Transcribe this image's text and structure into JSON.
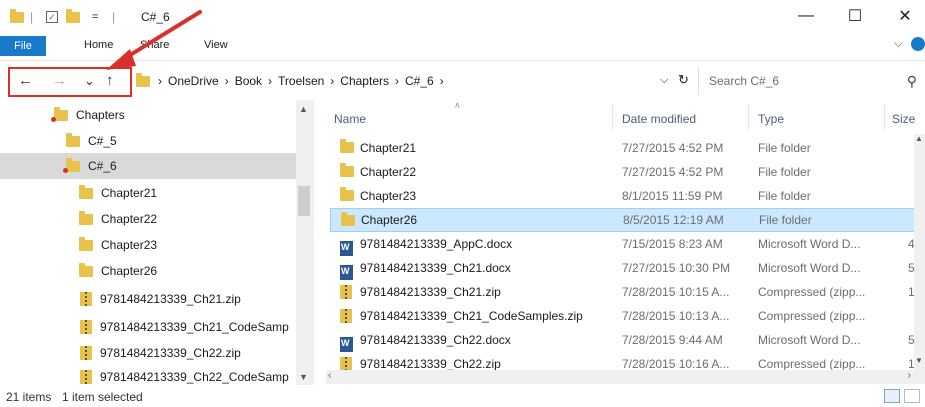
{
  "window": {
    "title": "C#_6",
    "qa_separator": "|",
    "qa_dropdown": "=",
    "min_glyph": "—",
    "max_glyph": "☐",
    "close_glyph": "✕"
  },
  "ribbon": {
    "tabs": [
      "File",
      "Home",
      "Share",
      "View"
    ],
    "expand_glyph": "⌵"
  },
  "address": {
    "back_glyph": "←",
    "forward_glyph": "→",
    "recent_glyph": "⌄",
    "up_glyph": "↑",
    "crumbs": [
      "›",
      "OneDrive",
      "›",
      "Book",
      "›",
      "Troelsen",
      "›",
      "Chapters",
      "›",
      "C#_6",
      "›"
    ],
    "dropdown_glyph": "⌵",
    "refresh_glyph": "↻",
    "search_placeholder": "Search C#_6",
    "search_glyph": "⚲"
  },
  "nav_tree": [
    {
      "label": "Chapters",
      "icon": "folder-pinned",
      "indent": 0,
      "selected": false
    },
    {
      "label": "C#_5",
      "icon": "folder",
      "indent": 1,
      "selected": false
    },
    {
      "label": "C#_6",
      "icon": "folder-pinned",
      "indent": 1,
      "selected": true
    },
    {
      "label": "Chapter21",
      "icon": "folder",
      "indent": 2,
      "selected": false
    },
    {
      "label": "Chapter22",
      "icon": "folder",
      "indent": 2,
      "selected": false
    },
    {
      "label": "Chapter23",
      "icon": "folder",
      "indent": 2,
      "selected": false
    },
    {
      "label": "Chapter26",
      "icon": "folder",
      "indent": 2,
      "selected": false
    },
    {
      "label": "9781484213339_Ch21.zip",
      "icon": "zip",
      "indent": 2,
      "selected": false
    },
    {
      "label": "9781484213339_Ch21_CodeSamp",
      "icon": "zip",
      "indent": 2,
      "selected": false
    },
    {
      "label": "9781484213339_Ch22.zip",
      "icon": "zip",
      "indent": 2,
      "selected": false
    },
    {
      "label": "9781484213339_Ch22_CodeSamp",
      "icon": "zip",
      "indent": 2,
      "selected": false
    }
  ],
  "columns": {
    "name": "Name",
    "date": "Date modified",
    "type": "Type",
    "size": "Size"
  },
  "files": [
    {
      "name": "Chapter21",
      "date": "7/27/2015 4:52 PM",
      "type": "File folder",
      "size": "",
      "icon": "folder",
      "selected": false
    },
    {
      "name": "Chapter22",
      "date": "7/27/2015 4:52 PM",
      "type": "File folder",
      "size": "",
      "icon": "folder",
      "selected": false
    },
    {
      "name": "Chapter23",
      "date": "8/1/2015 11:59 PM",
      "type": "File folder",
      "size": "",
      "icon": "folder",
      "selected": false
    },
    {
      "name": "Chapter26",
      "date": "8/5/2015 12:19 AM",
      "type": "File folder",
      "size": "",
      "icon": "folder",
      "selected": true
    },
    {
      "name": "9781484213339_AppC.docx",
      "date": "7/15/2015 8:23 AM",
      "type": "Microsoft Word D...",
      "size": "4",
      "icon": "docx",
      "selected": false
    },
    {
      "name": "9781484213339_Ch21.docx",
      "date": "7/27/2015 10:30 PM",
      "type": "Microsoft Word D...",
      "size": "5",
      "icon": "docx",
      "selected": false
    },
    {
      "name": "9781484213339_Ch21.zip",
      "date": "7/28/2015 10:15 A...",
      "type": "Compressed (zipp...",
      "size": "1",
      "icon": "zip",
      "selected": false
    },
    {
      "name": "9781484213339_Ch21_CodeSamples.zip",
      "date": "7/28/2015 10:13 A...",
      "type": "Compressed (zipp...",
      "size": "",
      "icon": "zip",
      "selected": false
    },
    {
      "name": "9781484213339_Ch22.docx",
      "date": "7/28/2015 9:44 AM",
      "type": "Microsoft Word D...",
      "size": "5",
      "icon": "docx",
      "selected": false
    },
    {
      "name": "9781484213339_Ch22.zip",
      "date": "7/28/2015 10:16 A...",
      "type": "Compressed (zipp...",
      "size": "1",
      "icon": "zip",
      "selected": false
    }
  ],
  "status": {
    "item_count": "21 items",
    "selection": "1 item selected"
  },
  "colors": {
    "accent": "#1979ca",
    "selection": "#cce8ff",
    "annotation": "#d9302a",
    "folder": "#e8c24a"
  }
}
